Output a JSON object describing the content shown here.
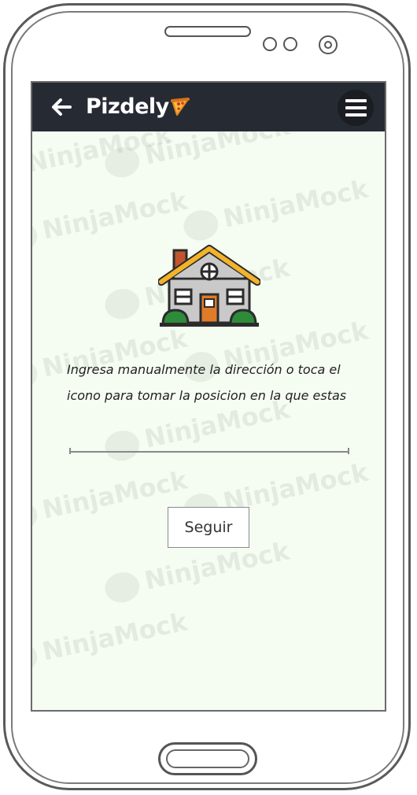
{
  "app": {
    "brand_name": "Pizdely",
    "back_icon": "arrow-left-icon",
    "menu_icon": "hamburger-menu-icon",
    "brand_icon": "pizza-slice-icon"
  },
  "main": {
    "illustration": "house-icon",
    "instruction_line1": "Ingresa manualmente la dirección o toca el",
    "instruction_line2": "icono para tomar la posicion en la que estas",
    "address_input": {
      "value": "",
      "placeholder": ""
    },
    "submit_label": "Seguir"
  },
  "watermark": {
    "text": "NinjaMock"
  },
  "colors": {
    "appbar": "#262a33",
    "screen_bg": "#f5fdf3",
    "roof": "#f3b32a",
    "house_wall": "#c9c9c9",
    "door": "#e07b2a",
    "bush": "#2e8b3a"
  }
}
